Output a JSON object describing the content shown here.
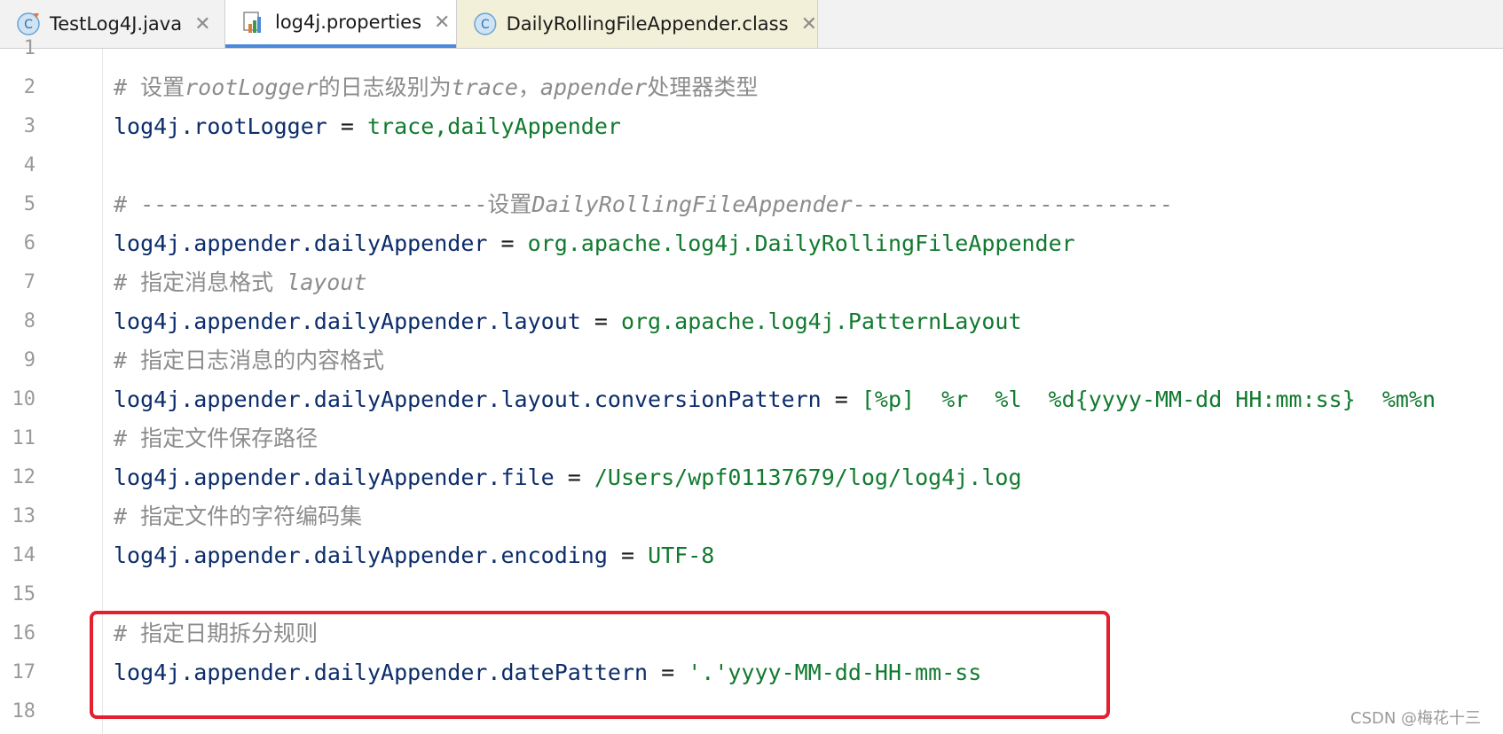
{
  "tabs": [
    {
      "label": "TestLog4J.java",
      "icon": "java-class-icon",
      "active": false
    },
    {
      "label": "log4j.properties",
      "icon": "properties-file-icon",
      "active": true
    },
    {
      "label": "DailyRollingFileAppender.class",
      "icon": "class-file-icon",
      "active": false
    }
  ],
  "lines": [
    {
      "num": "1"
    },
    {
      "num": "2",
      "comment_prefix": "# 设置",
      "comment_it1": "rootLogger",
      "comment_mid": "的日志级别为",
      "comment_it2": "trace",
      "comment_mid2": "，",
      "comment_it3": "appender",
      "comment_suffix": "处理器类型"
    },
    {
      "num": "3",
      "key": "log4j.rootLogger",
      "eq": " = ",
      "value": "trace,dailyAppender"
    },
    {
      "num": "4"
    },
    {
      "num": "5",
      "comment_prefix": "# --------------------------设置",
      "comment_it1": "DailyRollingFileAppender",
      "comment_suffix": "------------------------"
    },
    {
      "num": "6",
      "key": "log4j.appender.dailyAppender",
      "eq": " = ",
      "value": "org.apache.log4j.DailyRollingFileAppender"
    },
    {
      "num": "7",
      "comment_prefix": "# 指定消息格式 ",
      "comment_it1": "layout"
    },
    {
      "num": "8",
      "key": "log4j.appender.dailyAppender.layout",
      "eq": " = ",
      "value": "org.apache.log4j.PatternLayout"
    },
    {
      "num": "9",
      "comment_prefix": "# 指定日志消息的内容格式"
    },
    {
      "num": "10",
      "key": "log4j.appender.dailyAppender.layout.conversionPattern",
      "eq": " = ",
      "value": "[%p]  %r  %l  %d{yyyy-MM-dd HH:mm:ss}  %m%n"
    },
    {
      "num": "11",
      "comment_prefix": "# 指定文件保存路径"
    },
    {
      "num": "12",
      "key": "log4j.appender.dailyAppender.file",
      "eq": " = ",
      "value": "/Users/wpf01137679/log/log4j.log"
    },
    {
      "num": "13",
      "comment_prefix": "# 指定文件的字符编码集"
    },
    {
      "num": "14",
      "key": "log4j.appender.dailyAppender.encoding",
      "eq": " = ",
      "value": "UTF-8"
    },
    {
      "num": "15"
    },
    {
      "num": "16",
      "comment_prefix": "# 指定日期拆分规则"
    },
    {
      "num": "17",
      "key": "log4j.appender.dailyAppender.datePattern",
      "eq": " = ",
      "value": "'.'yyyy-MM-dd-HH-mm-ss"
    },
    {
      "num": "18"
    }
  ],
  "watermark": "CSDN @梅花十三",
  "colors": {
    "highlight": "#e5202e",
    "key": "#0c2d6b",
    "value": "#117a2f",
    "comment": "#8c8c8c",
    "active_tab": "#4a89dc"
  }
}
